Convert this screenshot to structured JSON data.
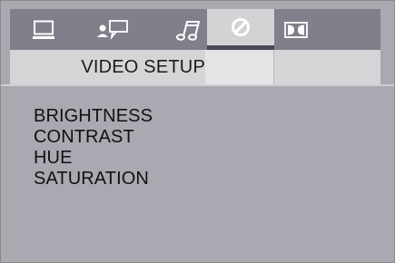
{
  "tabs": [
    {
      "icon": "monitor-icon"
    },
    {
      "icon": "person-speech-icon"
    },
    {
      "icon": "music-note-icon"
    },
    {
      "icon": "video-circle-slash-icon",
      "active": true
    },
    {
      "icon": "dolby-icon"
    }
  ],
  "header": {
    "title": "VIDEO SETUP"
  },
  "menu": {
    "items": [
      "BRIGHTNESS",
      "CONTRAST",
      "HUE",
      "SATURATION"
    ]
  }
}
